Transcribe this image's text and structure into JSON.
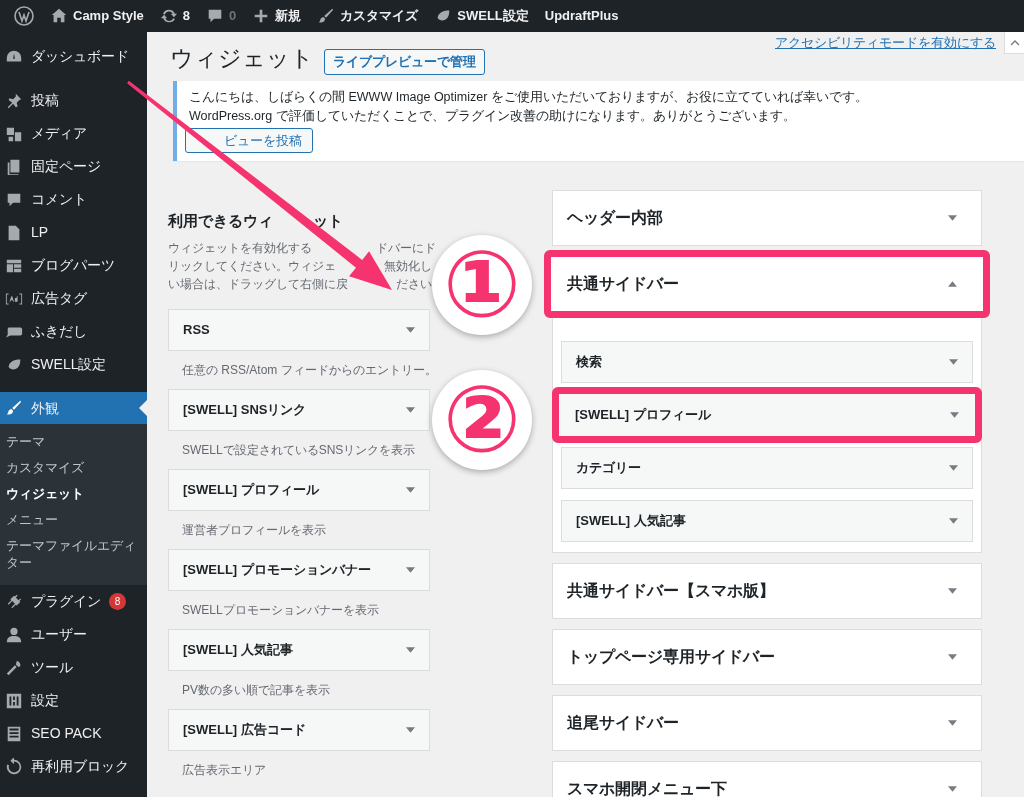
{
  "admin_bar": {
    "items": [
      {
        "kind": "wp-logo"
      },
      {
        "kind": "home",
        "label": "Camp Style"
      },
      {
        "kind": "updates",
        "label": "8"
      },
      {
        "kind": "comments",
        "label": "0"
      },
      {
        "kind": "new",
        "label": "新規"
      },
      {
        "kind": "brush",
        "label": "カスタマイズ"
      },
      {
        "kind": "swell",
        "label": "SWELL設定"
      },
      {
        "kind": "plain",
        "label": "UpdraftPlus"
      }
    ]
  },
  "sidebar": {
    "items": [
      {
        "label": "ダッシュボード",
        "selected": false
      },
      {
        "label": "投稿",
        "selected": false
      },
      {
        "label": "メディア",
        "selected": false
      },
      {
        "label": "固定ページ",
        "selected": false
      },
      {
        "label": "コメント",
        "selected": false
      },
      {
        "label": "LP",
        "selected": false
      },
      {
        "label": "ブログパーツ",
        "selected": false
      },
      {
        "label": "広告タグ",
        "selected": false
      },
      {
        "label": "ふきだし",
        "selected": false
      },
      {
        "label": "SWELL設定",
        "selected": false
      },
      {
        "label": "外観",
        "selected": true,
        "children": [
          {
            "label": "テーマ",
            "selected": false
          },
          {
            "label": "カスタマイズ",
            "selected": false
          },
          {
            "label": "ウィジェット",
            "selected": true
          },
          {
            "label": "メニュー",
            "selected": false
          },
          {
            "label": "テーマファイルエディター",
            "selected": false
          }
        ]
      },
      {
        "label": "プラグイン",
        "selected": false,
        "badge": "8"
      },
      {
        "label": "ユーザー",
        "selected": false
      },
      {
        "label": "ツール",
        "selected": false
      },
      {
        "label": "設定",
        "selected": false
      },
      {
        "label": "SEO PACK",
        "selected": false
      },
      {
        "label": "再利用ブロック",
        "selected": false
      }
    ]
  },
  "header": {
    "title": "ウィジェット",
    "action": "ライブプレビューで管理",
    "screen_link": "アクセシビリティモードを有効にする"
  },
  "notice": {
    "lines": [
      "こんにちは、しばらくの間 EWWW Image Optimizer をご使用いただいておりますが、お役に立てていれば幸いです。",
      "WordPress.org で評価していただくことで、プラグイン改善の助けになります。ありがとうございます。"
    ],
    "button": "ビューを投稿"
  },
  "available": {
    "title_parts": [
      "利用できるウィ",
      "ット"
    ],
    "description_lines": [
      [
        "ウィジェットを有効化する",
        "ドバーにド"
      ],
      [
        "リックしてください。ウィジェ",
        "無効化し"
      ],
      [
        "い場合は、ドラッグして右側に戻",
        "ださい"
      ]
    ],
    "widgets": [
      {
        "title": "RSS",
        "description": "任意の RSS/Atom フィードからのエントリー。"
      },
      {
        "title": "[SWELL] SNSリンク",
        "description": "SWELLで設定されているSNSリンクを表示"
      },
      {
        "title": "[SWELL] プロフィール",
        "description": "運営者プロフィールを表示"
      },
      {
        "title": "[SWELL] プロモーションバナー",
        "description": "SWELLプロモーションバナーを表示"
      },
      {
        "title": "[SWELL] 人気記事",
        "description": "PV数の多い順で記事を表示"
      },
      {
        "title": "[SWELL] 広告コード",
        "description": "広告表示エリア"
      }
    ]
  },
  "sidebars": [
    {
      "title": "ヘッダー内部",
      "expanded": false,
      "highlighted": false
    },
    {
      "title": "共通サイドバー",
      "expanded": true,
      "highlighted": true,
      "widgets": [
        {
          "title": "検索",
          "highlighted": false
        },
        {
          "title": "[SWELL] プロフィール",
          "highlighted": true
        },
        {
          "title": "カテゴリー",
          "highlighted": false
        },
        {
          "title": "[SWELL] 人気記事",
          "highlighted": false
        }
      ]
    },
    {
      "title": "共通サイドバー【スマホ版】",
      "expanded": false,
      "highlighted": false
    },
    {
      "title": "トップページ専用サイドバー",
      "expanded": false,
      "highlighted": false
    },
    {
      "title": "追尾サイドバー",
      "expanded": false,
      "highlighted": false
    },
    {
      "title": "スマホ開閉メニュー下",
      "expanded": false,
      "highlighted": false
    }
  ],
  "annotations": [
    {
      "kind": "arrow"
    },
    {
      "kind": "number",
      "label": "①"
    },
    {
      "kind": "number",
      "label": "②"
    }
  ]
}
